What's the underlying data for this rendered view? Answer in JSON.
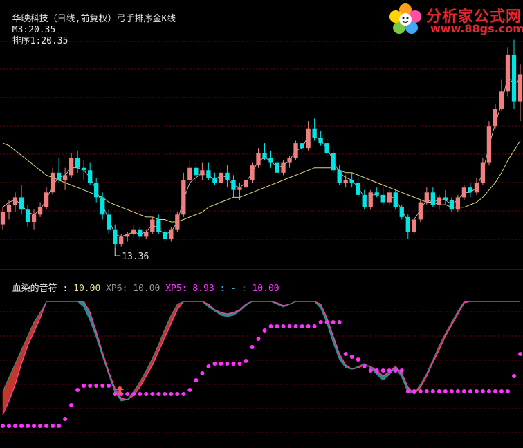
{
  "colors": {
    "up": "#f08080",
    "down": "#00e5e5",
    "neutral": "#4bbf4b",
    "ma": "#d8d880",
    "grid": "#7a0000",
    "sep": "#b00000",
    "label": "#e0e0e0",
    "osc_top": "#ff3aa0",
    "osc_red": "#c0392b",
    "osc_teal": "#2e8b8b",
    "dots": "#ff33ff",
    "arrow": "#ff5050"
  },
  "header_main": {
    "stock": "华映科技（日线,前复权）",
    "indicator": "弓手排序金K线",
    "m3_label": "M3:",
    "m3_value": "20.35",
    "rank_label": "排序1:",
    "rank_value": "20.35"
  },
  "header_sub": {
    "name": "血染的音符 :",
    "v1": "10.00",
    "xp6_label": "XP6:",
    "xp6_value": "10.00",
    "xp5_label": "XP5:",
    "xp5_value": "8.93",
    "last_label": ": - :",
    "last_value": "10.00"
  },
  "logo": {
    "title": "分析家公式网",
    "url": "www.88gs.com"
  },
  "chart_data": [
    {
      "type": "candlestick",
      "title": "华映科技（日线,前复权）",
      "annotations": [
        "13.36"
      ],
      "low_marker": "13.36",
      "candles": [
        [
          14.3,
          15.0,
          14.1,
          14.8
        ],
        [
          14.8,
          15.3,
          14.5,
          15.1
        ],
        [
          15.1,
          15.6,
          14.8,
          15.4
        ],
        [
          15.4,
          15.9,
          14.7,
          14.9
        ],
        [
          14.9,
          15.1,
          14.2,
          14.4
        ],
        [
          14.4,
          14.9,
          14.1,
          14.7
        ],
        [
          14.7,
          15.2,
          14.6,
          15.0
        ],
        [
          15.0,
          15.8,
          14.9,
          15.6
        ],
        [
          15.6,
          16.6,
          15.5,
          16.4
        ],
        [
          16.4,
          17.0,
          16.0,
          16.1
        ],
        [
          16.1,
          16.6,
          15.7,
          16.3
        ],
        [
          16.3,
          17.2,
          16.2,
          17.0
        ],
        [
          17.0,
          17.3,
          16.4,
          16.6
        ],
        [
          16.6,
          16.9,
          16.1,
          16.5
        ],
        [
          16.5,
          16.8,
          15.9,
          16.0
        ],
        [
          16.0,
          16.2,
          15.2,
          15.4
        ],
        [
          15.4,
          15.6,
          14.5,
          14.7
        ],
        [
          14.7,
          14.9,
          13.9,
          14.1
        ],
        [
          14.1,
          14.3,
          13.36,
          13.5
        ],
        [
          13.5,
          13.9,
          13.4,
          13.8
        ],
        [
          13.8,
          14.0,
          13.6,
          13.9
        ],
        [
          13.9,
          14.3,
          13.8,
          14.1
        ],
        [
          14.1,
          14.2,
          13.7,
          13.8
        ],
        [
          13.8,
          14.1,
          13.7,
          14.0
        ],
        [
          14.0,
          14.6,
          13.9,
          14.5
        ],
        [
          14.5,
          14.7,
          13.9,
          14.0
        ],
        [
          14.0,
          14.1,
          13.6,
          13.7
        ],
        [
          13.7,
          14.2,
          13.6,
          14.1
        ],
        [
          14.1,
          14.8,
          14.0,
          14.7
        ],
        [
          14.7,
          16.4,
          14.6,
          16.1
        ],
        [
          16.1,
          16.9,
          15.9,
          16.6
        ],
        [
          16.6,
          16.8,
          16.0,
          16.3
        ],
        [
          16.3,
          16.8,
          16.1,
          16.5
        ],
        [
          16.5,
          16.8,
          16.1,
          16.2
        ],
        [
          16.2,
          16.4,
          15.9,
          16.0
        ],
        [
          16.0,
          16.6,
          15.7,
          16.4
        ],
        [
          16.4,
          16.7,
          15.8,
          16.1
        ],
        [
          16.1,
          16.3,
          15.4,
          15.7
        ],
        [
          15.7,
          16.0,
          15.3,
          15.8
        ],
        [
          15.8,
          16.2,
          15.6,
          16.1
        ],
        [
          16.1,
          16.8,
          16.0,
          16.7
        ],
        [
          16.7,
          17.4,
          16.6,
          17.2
        ],
        [
          17.2,
          17.6,
          16.9,
          17.0
        ],
        [
          17.0,
          17.3,
          16.6,
          16.8
        ],
        [
          16.8,
          16.9,
          16.3,
          16.4
        ],
        [
          16.4,
          16.9,
          16.3,
          16.8
        ],
        [
          16.8,
          17.1,
          16.6,
          17.0
        ],
        [
          17.0,
          17.7,
          16.9,
          17.6
        ],
        [
          17.6,
          17.9,
          17.2,
          17.4
        ],
        [
          17.4,
          18.5,
          17.3,
          18.2
        ],
        [
          18.2,
          18.6,
          17.7,
          17.8
        ],
        [
          17.8,
          18.1,
          17.5,
          17.6
        ],
        [
          17.6,
          17.8,
          17.1,
          17.2
        ],
        [
          17.2,
          17.4,
          16.4,
          16.5
        ],
        [
          16.5,
          16.7,
          15.9,
          16.0
        ],
        [
          16.0,
          16.3,
          15.8,
          16.1
        ],
        [
          16.1,
          16.4,
          15.8,
          16.0
        ],
        [
          16.0,
          16.2,
          15.4,
          15.5
        ],
        [
          15.5,
          15.7,
          14.9,
          15.0
        ],
        [
          15.0,
          15.7,
          14.9,
          15.6
        ],
        [
          15.6,
          15.8,
          15.4,
          15.5
        ],
        [
          15.5,
          15.8,
          15.1,
          15.2
        ],
        [
          15.2,
          15.7,
          15.1,
          15.6
        ],
        [
          15.6,
          15.7,
          14.9,
          15.0
        ],
        [
          15.0,
          15.1,
          14.5,
          14.6
        ],
        [
          14.6,
          14.7,
          13.7,
          14.0
        ],
        [
          14.0,
          14.6,
          13.9,
          14.5
        ],
        [
          14.5,
          15.3,
          14.4,
          15.2
        ],
        [
          15.2,
          15.8,
          15.1,
          15.6
        ],
        [
          15.6,
          15.8,
          15.0,
          15.1
        ],
        [
          15.1,
          15.5,
          14.9,
          15.4
        ],
        [
          15.4,
          15.7,
          15.1,
          15.3
        ],
        [
          15.3,
          15.4,
          14.8,
          14.9
        ],
        [
          14.9,
          15.5,
          14.8,
          15.4
        ],
        [
          15.4,
          15.9,
          15.3,
          15.8
        ],
        [
          15.8,
          16.0,
          15.4,
          15.6
        ],
        [
          15.6,
          16.2,
          15.5,
          16.0
        ],
        [
          16.0,
          17.0,
          15.9,
          16.8
        ],
        [
          16.8,
          18.5,
          16.7,
          18.3
        ],
        [
          18.3,
          19.2,
          18.2,
          19.0
        ],
        [
          19.0,
          20.2,
          18.9,
          19.7
        ],
        [
          19.7,
          21.5,
          19.5,
          21.2
        ],
        [
          21.2,
          21.8,
          19.0,
          19.3
        ],
        [
          19.3,
          20.8,
          18.5,
          20.4
        ]
      ],
      "ma_line": [
        17.6,
        17.5,
        17.3,
        17.1,
        16.9,
        16.7,
        16.5,
        16.3,
        16.2,
        16.1,
        16.0,
        15.9,
        15.8,
        15.7,
        15.6,
        15.5,
        15.4,
        15.2,
        15.1,
        15.0,
        14.9,
        14.8,
        14.7,
        14.6,
        14.6,
        14.5,
        14.5,
        14.4,
        14.4,
        14.5,
        14.6,
        14.7,
        14.8,
        15.0,
        15.1,
        15.2,
        15.3,
        15.4,
        15.4,
        15.5,
        15.6,
        15.7,
        15.8,
        15.9,
        16.0,
        16.1,
        16.2,
        16.3,
        16.4,
        16.5,
        16.6,
        16.6,
        16.6,
        16.6,
        16.5,
        16.4,
        16.4,
        16.3,
        16.2,
        16.1,
        16.0,
        15.9,
        15.8,
        15.7,
        15.6,
        15.5,
        15.4,
        15.3,
        15.2,
        15.2,
        15.1,
        15.1,
        15.0,
        15.0,
        15.0,
        15.1,
        15.2,
        15.4,
        15.7,
        16.0,
        16.4,
        16.9,
        17.3,
        17.7
      ],
      "fast_line": [
        15.0,
        15.2,
        15.3,
        15.1,
        14.8,
        14.7,
        14.9,
        15.3,
        15.9,
        16.2,
        16.3,
        16.6,
        16.6,
        16.5,
        16.2,
        15.7,
        15.1,
        14.5,
        13.9,
        13.8,
        13.9,
        14.0,
        13.9,
        14.0,
        14.3,
        14.1,
        13.9,
        14.0,
        14.4,
        15.3,
        16.0,
        16.2,
        16.4,
        16.3,
        16.1,
        16.3,
        16.2,
        15.9,
        15.8,
        16.0,
        16.4,
        16.9,
        17.0,
        16.9,
        16.6,
        16.7,
        16.9,
        17.3,
        17.4,
        17.9,
        17.9,
        17.7,
        17.4,
        16.9,
        16.4,
        16.2,
        16.1,
        15.8,
        15.4,
        15.5,
        15.5,
        15.4,
        15.5,
        15.3,
        14.9,
        14.4,
        14.5,
        14.9,
        15.3,
        15.2,
        15.3,
        15.3,
        15.1,
        15.3,
        15.6,
        15.6,
        15.8,
        16.4,
        17.5,
        18.4,
        19.2,
        20.3,
        20.0,
        20.2
      ]
    },
    {
      "type": "line",
      "title": "血染的音符",
      "series": [
        {
          "name": "血染的音符",
          "values": [
            3.5,
            4.5,
            5.5,
            6.5,
            7.5,
            8.5,
            9.2,
            10,
            10,
            10,
            10,
            10,
            10,
            9.6,
            8.6,
            7.4,
            6.0,
            4.7,
            3.4,
            2.8,
            2.9,
            3.5,
            4.2,
            5.0,
            5.9,
            6.9,
            8.0,
            9.0,
            9.8,
            10,
            10,
            10,
            10,
            9.6,
            9.3,
            9.0,
            8.9,
            9.0,
            9.3,
            9.7,
            10,
            10,
            10,
            10,
            9.8,
            9.6,
            9.8,
            10,
            10,
            10,
            10,
            9.5,
            8.4,
            7.0,
            5.8,
            5.2,
            5.1,
            5.3,
            5.5,
            5.2,
            4.7,
            4.3,
            4.7,
            5.2,
            4.5,
            3.4,
            3.4,
            4.0,
            4.8,
            5.8,
            6.8,
            7.7,
            8.5,
            9.3,
            10,
            10,
            10,
            10,
            10,
            10,
            10,
            10,
            10,
            10
          ]
        },
        {
          "name": "XP6",
          "values": [
            1.8,
            2.8,
            4.0,
            5.5,
            6.8,
            7.8,
            8.8,
            10,
            10,
            10,
            10,
            10,
            10,
            10,
            9.2,
            7.8,
            6.3,
            4.9,
            3.7,
            3.0,
            2.9,
            3.2,
            3.8,
            4.6,
            5.4,
            6.4,
            7.4,
            8.4,
            9.4,
            10,
            10,
            10,
            10,
            9.8,
            9.4,
            9.2,
            9.1,
            9.2,
            9.4,
            9.8,
            10,
            10,
            10,
            10,
            9.9,
            9.7,
            9.8,
            10,
            10,
            10,
            10,
            9.8,
            8.8,
            7.5,
            6.2,
            5.4,
            5.1,
            5.2,
            5.4,
            5.3,
            5.0,
            4.6,
            4.9,
            5.3,
            4.8,
            3.8,
            3.3,
            3.8,
            4.6,
            5.6,
            6.5,
            7.5,
            8.3,
            9.1,
            9.9,
            10,
            10,
            10,
            10,
            10,
            10,
            10,
            10,
            10
          ]
        },
        {
          "name": "XP5",
          "values": [
            1.0,
            1.0,
            1.0,
            1.0,
            1.0,
            1.0,
            1.0,
            1.0,
            1.0,
            1.0,
            1.5,
            2.5,
            3.6,
            3.9,
            3.9,
            3.9,
            3.9,
            3.9,
            3.3,
            3.3,
            3.3,
            3.3,
            3.3,
            3.3,
            3.3,
            3.3,
            3.3,
            3.3,
            3.3,
            3.3,
            3.6,
            4.3,
            4.8,
            5.3,
            5.5,
            5.5,
            5.5,
            5.5,
            5.5,
            5.7,
            6.7,
            7.3,
            7.9,
            8.2,
            8.2,
            8.2,
            8.2,
            8.2,
            8.2,
            8.2,
            8.2,
            8.5,
            8.5,
            8.5,
            8.5,
            6.2,
            6.0,
            5.8,
            5.3,
            5.0,
            5.0,
            5.0,
            5.0,
            5.0,
            5.0,
            3.5,
            3.5,
            3.5,
            3.5,
            3.5,
            3.5,
            3.5,
            3.5,
            3.5,
            3.5,
            3.5,
            3.5,
            3.5,
            3.5,
            3.5,
            3.5,
            3.5,
            4.6,
            6.2
          ]
        }
      ],
      "ylim": [
        0,
        10
      ]
    }
  ]
}
